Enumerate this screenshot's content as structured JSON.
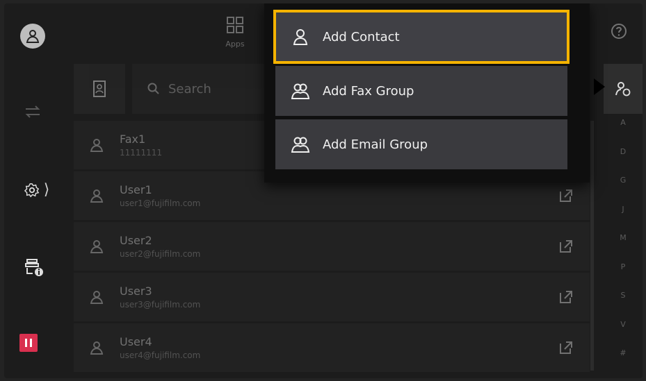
{
  "top": {
    "apps_label": "Apps"
  },
  "search": {
    "placeholder": "Search"
  },
  "menu": {
    "items": [
      {
        "label": "Add Contact",
        "icon": "person-icon",
        "highlighted": true
      },
      {
        "label": "Add Fax Group",
        "icon": "group-icon"
      },
      {
        "label": "Add Email Group",
        "icon": "group-icon"
      }
    ]
  },
  "contacts": [
    {
      "name": "Fax1",
      "detail": "11111111"
    },
    {
      "name": "User1",
      "detail": "user1@fujifilm.com"
    },
    {
      "name": "User2",
      "detail": "user2@fujifilm.com"
    },
    {
      "name": "User3",
      "detail": "user3@fujifilm.com"
    },
    {
      "name": "User4",
      "detail": "user4@fujifilm.com"
    }
  ],
  "alpha_index": [
    "A",
    "D",
    "G",
    "J",
    "M",
    "P",
    "S",
    "V",
    "#"
  ],
  "colors": {
    "highlight": "#f5b301",
    "pause": "#d9304f"
  }
}
